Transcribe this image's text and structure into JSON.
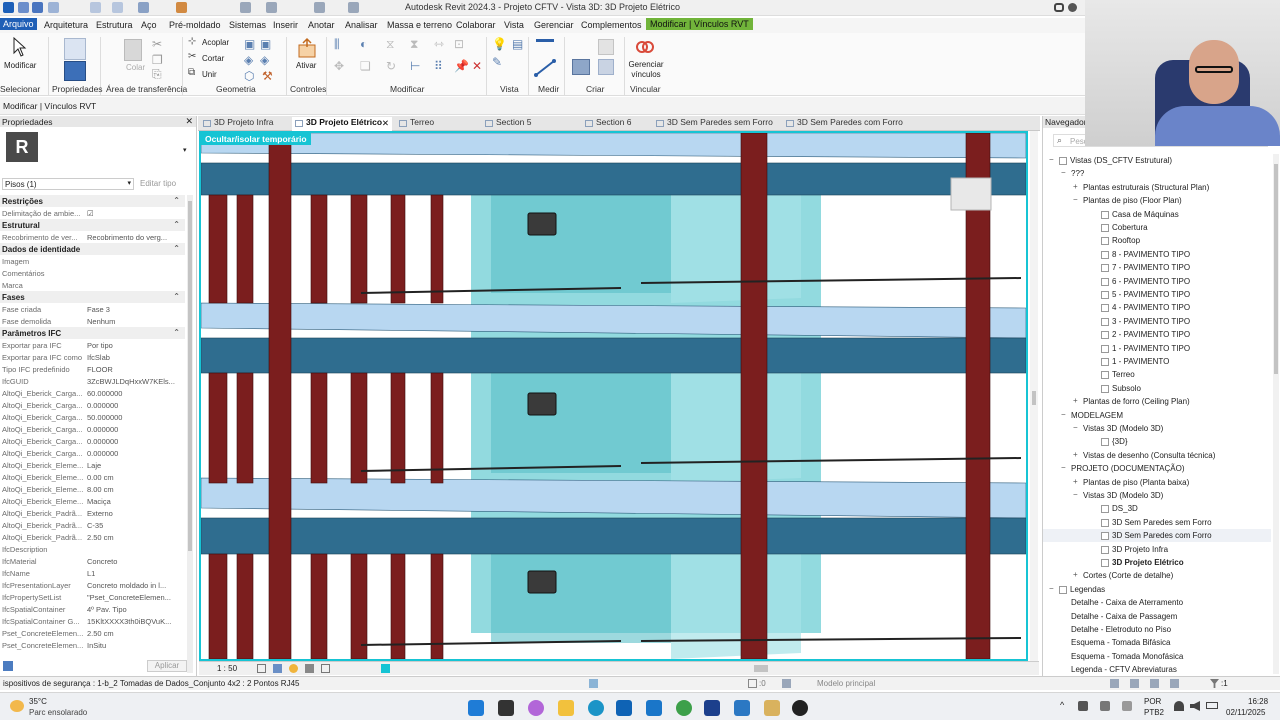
{
  "window": {
    "title": "Autodesk Revit 2024.3 - Projeto CFTV - Vista 3D: 3D Projeto Elétrico",
    "user_initial": "b"
  },
  "menu": {
    "items": [
      "Arquivo",
      "Arquitetura",
      "Estrutura",
      "Aço",
      "Pré-moldado",
      "Sistemas",
      "Inserir",
      "Anotar",
      "Analisar",
      "Massa e terreno",
      "Colaborar",
      "Vista",
      "Gerenciar",
      "Complementos",
      "Modificar | Vínculos RVT"
    ]
  },
  "ribbon": {
    "modify_label": "Modificar",
    "copy_label": "Copiar",
    "paste_label": "Colar",
    "acoplar_label": "Acoplar",
    "cortar_label": "Cortar",
    "unir_label": "Unir",
    "ativar_label": "Ativar",
    "gerenciar_label": "Gerenciar vínculos",
    "groups": [
      "Selecionar",
      "Propriedades",
      "Área de transferência",
      "Geometria",
      "Controles",
      "Modificar",
      "Vista",
      "Medir",
      "Criar",
      "Vincular"
    ]
  },
  "options_bar": {
    "context": "Modificar | Vínculos RVT"
  },
  "properties": {
    "title": "Propriedades",
    "type_selector": "Pisos (1)",
    "edit_type": "Editar tipo",
    "apply_button": "Aplicar",
    "sections": [
      {
        "name": "Restrições",
        "rows": [
          {
            "k": "Delimitação de ambie...",
            "v": "☑"
          }
        ]
      },
      {
        "name": "Estrutural",
        "rows": [
          {
            "k": "Recobrimento de ver...",
            "v": "Recobrimento do verg..."
          }
        ]
      },
      {
        "name": "Dados de identidade",
        "rows": [
          {
            "k": "Imagem",
            "v": ""
          },
          {
            "k": "Comentários",
            "v": ""
          },
          {
            "k": "Marca",
            "v": ""
          }
        ]
      },
      {
        "name": "Fases",
        "rows": [
          {
            "k": "Fase criada",
            "v": "Fase 3"
          },
          {
            "k": "Fase demolida",
            "v": "Nenhum"
          }
        ]
      },
      {
        "name": "Parâmetros IFC",
        "rows": [
          {
            "k": "Exportar para IFC",
            "v": "Por tipo"
          },
          {
            "k": "Exportar para IFC como",
            "v": "IfcSlab"
          },
          {
            "k": "Tipo IFC predefinido",
            "v": "FLOOR"
          },
          {
            "k": "IfcGUID",
            "v": "3ZcBWJLDqHxxW7KEls..."
          },
          {
            "k": "AltoQi_Eberick_Carga...",
            "v": "60.000000"
          },
          {
            "k": "AltoQi_Eberick_Carga...",
            "v": "0.000000"
          },
          {
            "k": "AltoQi_Eberick_Carga...",
            "v": "50.000000"
          },
          {
            "k": "AltoQi_Eberick_Carga...",
            "v": "0.000000"
          },
          {
            "k": "AltoQi_Eberick_Carga...",
            "v": "0.000000"
          },
          {
            "k": "AltoQi_Eberick_Carga...",
            "v": "0.000000"
          },
          {
            "k": "AltoQi_Eberick_Eleme...",
            "v": "Laje"
          },
          {
            "k": "AltoQi_Eberick_Eleme...",
            "v": "0.00 cm"
          },
          {
            "k": "AltoQi_Eberick_Eleme...",
            "v": "8.00 cm"
          },
          {
            "k": "AltoQi_Eberick_Eleme...",
            "v": "Maciça"
          },
          {
            "k": "AltoQi_Eberick_Padrã...",
            "v": "Externo"
          },
          {
            "k": "AltoQi_Eberick_Padrã...",
            "v": "C-35"
          },
          {
            "k": "AltoQi_Eberick_Padrã...",
            "v": "2.50 cm"
          },
          {
            "k": "IfcDescription",
            "v": ""
          },
          {
            "k": "IfcMaterial",
            "v": "Concreto"
          },
          {
            "k": "IfcName",
            "v": "L1"
          },
          {
            "k": "IfcPresentationLayer",
            "v": "Concreto moldado in l..."
          },
          {
            "k": "IfcPropertySetList",
            "v": "\"Pset_ConcreteElemen..."
          },
          {
            "k": "IfcSpatialContainer",
            "v": "4º Pav. Tipo"
          },
          {
            "k": "IfcSpatialContainer G...",
            "v": "15KltXXXX3th0iBQVuK..."
          },
          {
            "k": "Pset_ConcreteElemen...",
            "v": "2.50 cm"
          },
          {
            "k": "Pset_ConcreteElemen...",
            "v": "InSitu"
          }
        ]
      }
    ]
  },
  "tabs": [
    "3D Projeto Infra",
    "3D Projeto Elétrico",
    "Terreo",
    "Section 5",
    "Section 6",
    "3D Sem Paredes sem Forro",
    "3D Sem Paredes com Forro"
  ],
  "viewport": {
    "banner": "Ocultar/isolar temporário"
  },
  "view_bar": {
    "scale": "1 : 50"
  },
  "navigator": {
    "title": "Navegador",
    "search_placeholder": "Pesq",
    "items": [
      {
        "level": 0,
        "exp": "−",
        "label": "Vistas (DS_CFTV Estrutural)",
        "icon": true
      },
      {
        "level": 1,
        "exp": "−",
        "label": "???"
      },
      {
        "level": 2,
        "exp": "+",
        "label": "Plantas estruturais (Structural Plan)"
      },
      {
        "level": 2,
        "exp": "−",
        "label": "Plantas de piso (Floor Plan)"
      },
      {
        "level": 3,
        "label": "Casa de Máquinas",
        "icon": true
      },
      {
        "level": 3,
        "label": "Cobertura",
        "icon": true
      },
      {
        "level": 3,
        "label": "Rooftop",
        "icon": true
      },
      {
        "level": 3,
        "label": "8 - PAVIMENTO TIPO",
        "icon": true
      },
      {
        "level": 3,
        "label": "7 - PAVIMENTO TIPO",
        "icon": true
      },
      {
        "level": 3,
        "label": "6 - PAVIMENTO TIPO",
        "icon": true
      },
      {
        "level": 3,
        "label": "5 - PAVIMENTO TIPO",
        "icon": true
      },
      {
        "level": 3,
        "label": "4 - PAVIMENTO TIPO",
        "icon": true
      },
      {
        "level": 3,
        "label": "3 - PAVIMENTO TIPO",
        "icon": true
      },
      {
        "level": 3,
        "label": "2 - PAVIMENTO TIPO",
        "icon": true
      },
      {
        "level": 3,
        "label": "1 - PAVIMENTO TIPO",
        "icon": true
      },
      {
        "level": 3,
        "label": "1 - PAVIMENTO",
        "icon": true
      },
      {
        "level": 3,
        "label": "Terreo",
        "icon": true
      },
      {
        "level": 3,
        "label": "Subsolo",
        "icon": true
      },
      {
        "level": 2,
        "exp": "+",
        "label": "Plantas de forro (Ceiling Plan)"
      },
      {
        "level": 1,
        "exp": "−",
        "label": "MODELAGEM"
      },
      {
        "level": 2,
        "exp": "−",
        "label": "Vistas 3D (Modelo 3D)"
      },
      {
        "level": 3,
        "label": "{3D}",
        "icon": true
      },
      {
        "level": 2,
        "exp": "+",
        "label": "Vistas de desenho (Consulta técnica)"
      },
      {
        "level": 1,
        "exp": "−",
        "label": "PROJETO (DOCUMENTAÇÃO)"
      },
      {
        "level": 2,
        "exp": "+",
        "label": "Plantas de piso (Planta baixa)"
      },
      {
        "level": 2,
        "exp": "−",
        "label": "Vistas 3D (Modelo 3D)"
      },
      {
        "level": 3,
        "label": "DS_3D",
        "icon": true
      },
      {
        "level": 3,
        "label": "3D Sem Paredes sem Forro",
        "icon": true
      },
      {
        "level": 3,
        "label": "3D Sem Paredes com Forro",
        "icon": true,
        "highlight": true
      },
      {
        "level": 3,
        "label": "3D Projeto Infra",
        "icon": true
      },
      {
        "level": 3,
        "label": "3D Projeto Elétrico",
        "icon": true,
        "bold": true
      },
      {
        "level": 2,
        "exp": "+",
        "label": "Cortes (Corte de detalhe)"
      },
      {
        "level": 0,
        "exp": "−",
        "label": "Legendas",
        "icon": true
      },
      {
        "level": 1,
        "label": "Detalhe - Caixa de Aterramento"
      },
      {
        "level": 1,
        "label": "Detalhe - Caixa de Passagem"
      },
      {
        "level": 1,
        "label": "Detalhe - Eletroduto no Piso"
      },
      {
        "level": 1,
        "label": "Esquema - Tomada Bifásica"
      },
      {
        "level": 1,
        "label": "Esquema - Tomada Monofásica"
      },
      {
        "level": 1,
        "label": "Legenda - CFTV Abreviaturas"
      }
    ]
  },
  "status": {
    "message": "ispositivos de segurança : 1-b_2 Tomadas de Dados_Conjunto 4x2 : 2 Pontos RJ45",
    "selection_count": ":0",
    "model": "Modelo principal",
    "filter_count": ":1"
  },
  "taskbar": {
    "temp": "35°C",
    "weather": "Parc ensolarado",
    "lang": "POR",
    "kbd": "PTB2",
    "time": "16:28",
    "date": "02/11/2025"
  }
}
